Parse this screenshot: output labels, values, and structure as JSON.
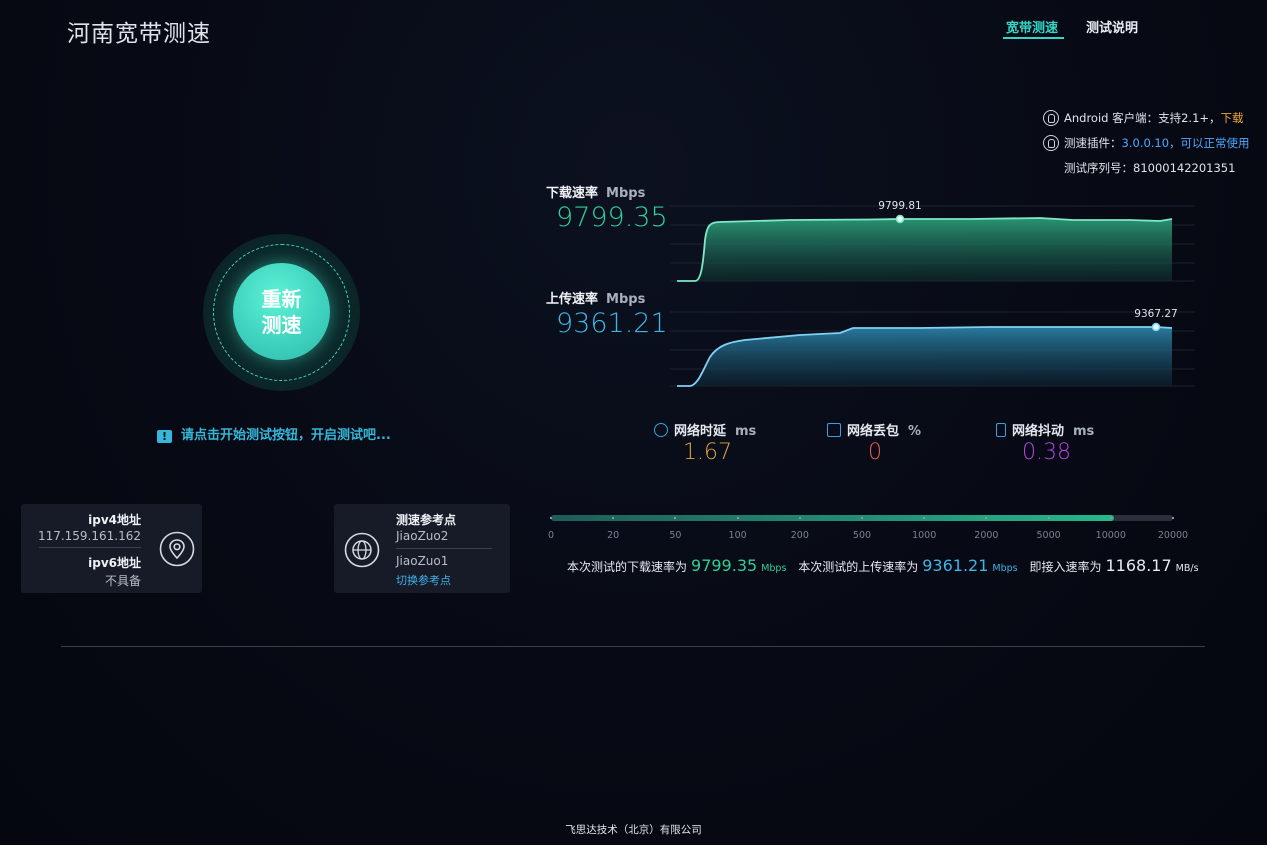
{
  "header": {
    "brand": "河南宽带测速",
    "nav": [
      {
        "label": "宽带测速",
        "active": true
      },
      {
        "label": "测试说明",
        "active": false
      }
    ]
  },
  "info": {
    "android_label": "Android 客户端：支持2.1+，",
    "android_link": "下载",
    "plugin_label": "测速插件：",
    "plugin_version": "3.0.0.10，可以正常使用",
    "serial_label": "测试序列号：",
    "serial_value": "81000142201351"
  },
  "restart": {
    "line1": "重新",
    "line2": "测速"
  },
  "hint": "请点击开始测试按钮，开启测试吧...",
  "ip_card": {
    "ipv4_label": "ipv4地址",
    "ipv4_value": "117.159.161.162",
    "ipv6_label": "ipv6地址",
    "ipv6_value": "不具备"
  },
  "ref_card": {
    "label": "测速参考点",
    "primary": "JiaoZuo2",
    "secondary": "JiaoZuo1",
    "switch_link": "切换参考点"
  },
  "download": {
    "label": "下载速率",
    "unit": "Mbps",
    "value": "9799.35",
    "peak": "9799.81",
    "color": "#2fcf95"
  },
  "upload": {
    "label": "上传速率",
    "unit": "Mbps",
    "value": "9361.21",
    "peak": "9367.27",
    "color": "#3fb5e8"
  },
  "stats": [
    {
      "label": "网络时延",
      "unit": "ms",
      "value": "1.67",
      "color": "#e0a13e"
    },
    {
      "label": "网络丢包",
      "unit": "%",
      "value": "0",
      "color": "#ef5a4d"
    },
    {
      "label": "网络抖动",
      "unit": "ms",
      "value": "0.38",
      "color": "#b046e0"
    }
  ],
  "scale": {
    "ticks": [
      "0",
      "20",
      "50",
      "100",
      "200",
      "500",
      "1000",
      "2000",
      "5000",
      "10000",
      "20000"
    ],
    "progress_fraction": 0.905
  },
  "summary": {
    "dl_prefix": "本次测试的下载速率为",
    "dl_value": "9799.35",
    "dl_unit": "Mbps",
    "ul_prefix": "本次测试的上传速率为",
    "ul_value": "9361.21",
    "ul_unit": "Mbps",
    "access_prefix": "即接入速率为",
    "access_value": "1168.17",
    "access_unit": "MB/s"
  },
  "footer": "飞思达技术（北京）有限公司"
}
